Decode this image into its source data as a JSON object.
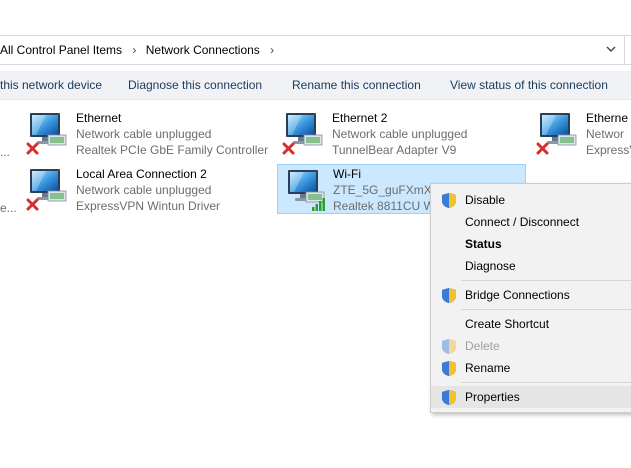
{
  "address": {
    "crumbs": [
      "All Control Panel Items",
      "Network Connections"
    ]
  },
  "commands": {
    "device": "this network device",
    "diagnose": "Diagnose this connection",
    "rename": "Rename this connection",
    "status": "View status of this connection"
  },
  "left_truncated": [
    "...",
    "e..."
  ],
  "items": [
    {
      "name": "Ethernet",
      "status": "Network cable unplugged",
      "device": "Realtek PCIe GbE Family Controller"
    },
    {
      "name": "Ethernet 2",
      "status": "Network cable unplugged",
      "device": "TunnelBear Adapter V9"
    },
    {
      "name": "Etherne",
      "status": "Networ",
      "device": "ExpressV"
    },
    {
      "name": "Local Area Connection 2",
      "status": "Network cable unplugged",
      "device": "ExpressVPN Wintun Driver"
    },
    {
      "name": "Wi-Fi",
      "status": "ZTE_5G_guFXmX",
      "device": "Realtek 8811CU W"
    }
  ],
  "menu": {
    "disable": "Disable",
    "connect": "Connect / Disconnect",
    "status": "Status",
    "diagnose": "Diagnose",
    "bridge": "Bridge Connections",
    "shortcut": "Create Shortcut",
    "delete": "Delete",
    "rename": "Rename",
    "properties": "Properties"
  },
  "colors": {
    "accent": "#1b3a5c",
    "selection": "#cce8ff",
    "selection_border": "#99d1ff",
    "error_x": "#d32f2f",
    "wifi_bars": "#2e9e2e"
  },
  "icons": {
    "network": "monitor-network-icon",
    "unplugged": "red-x-icon",
    "wifi": "signal-bars-icon",
    "shield": "uac-shield-icon"
  }
}
